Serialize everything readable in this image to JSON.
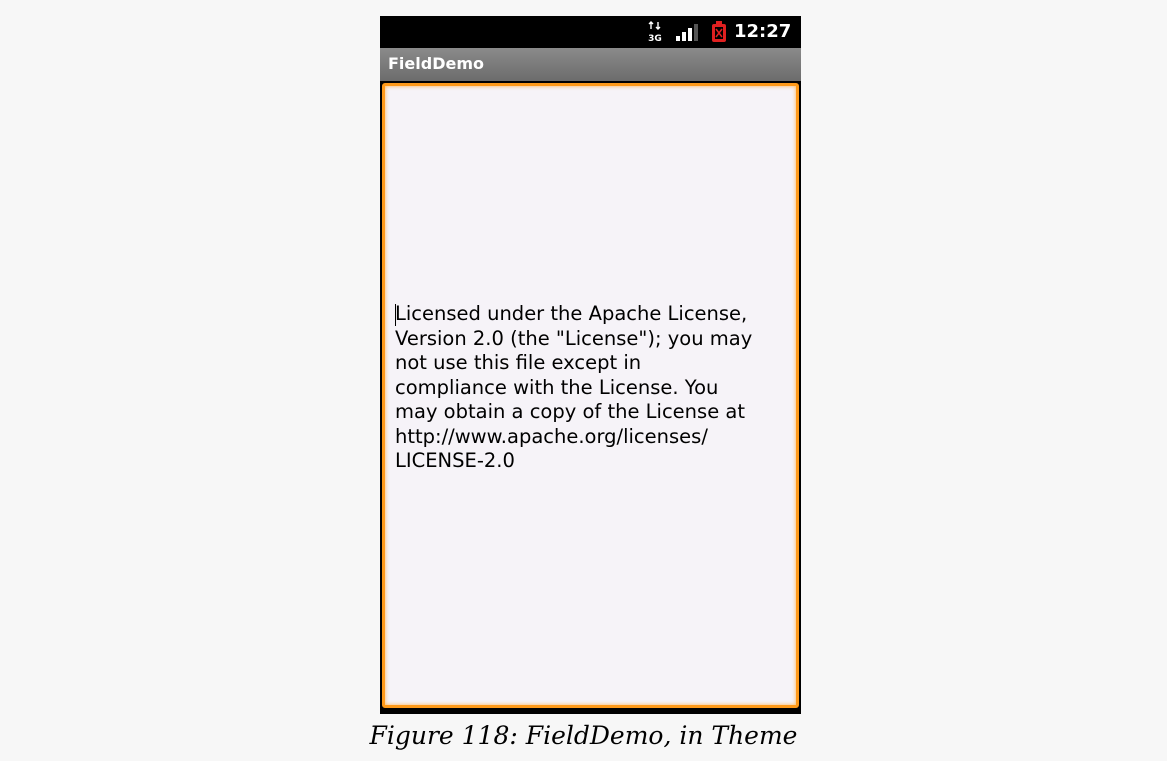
{
  "status_bar": {
    "network_label": "3G",
    "network_icon": "3g-data-icon",
    "signal_icon": "signal-strength-icon",
    "battery_icon": "battery-low-icon",
    "time": "12:27"
  },
  "app": {
    "title": "FieldDemo"
  },
  "field": {
    "text": "Licensed under the Apache License,\nVersion 2.0 (the \"License\"); you may\nnot use this file except in\ncompliance with the License. You\nmay obtain a copy of the License at\nhttp://www.apache.org/licenses/\nLICENSE-2.0"
  },
  "caption": "Figure 118: FieldDemo, in Theme",
  "colors": {
    "focus_border": "#ff9a1a",
    "field_background": "#f6f3f8",
    "title_bar": "#7a7a7a",
    "battery": "#e02020"
  }
}
